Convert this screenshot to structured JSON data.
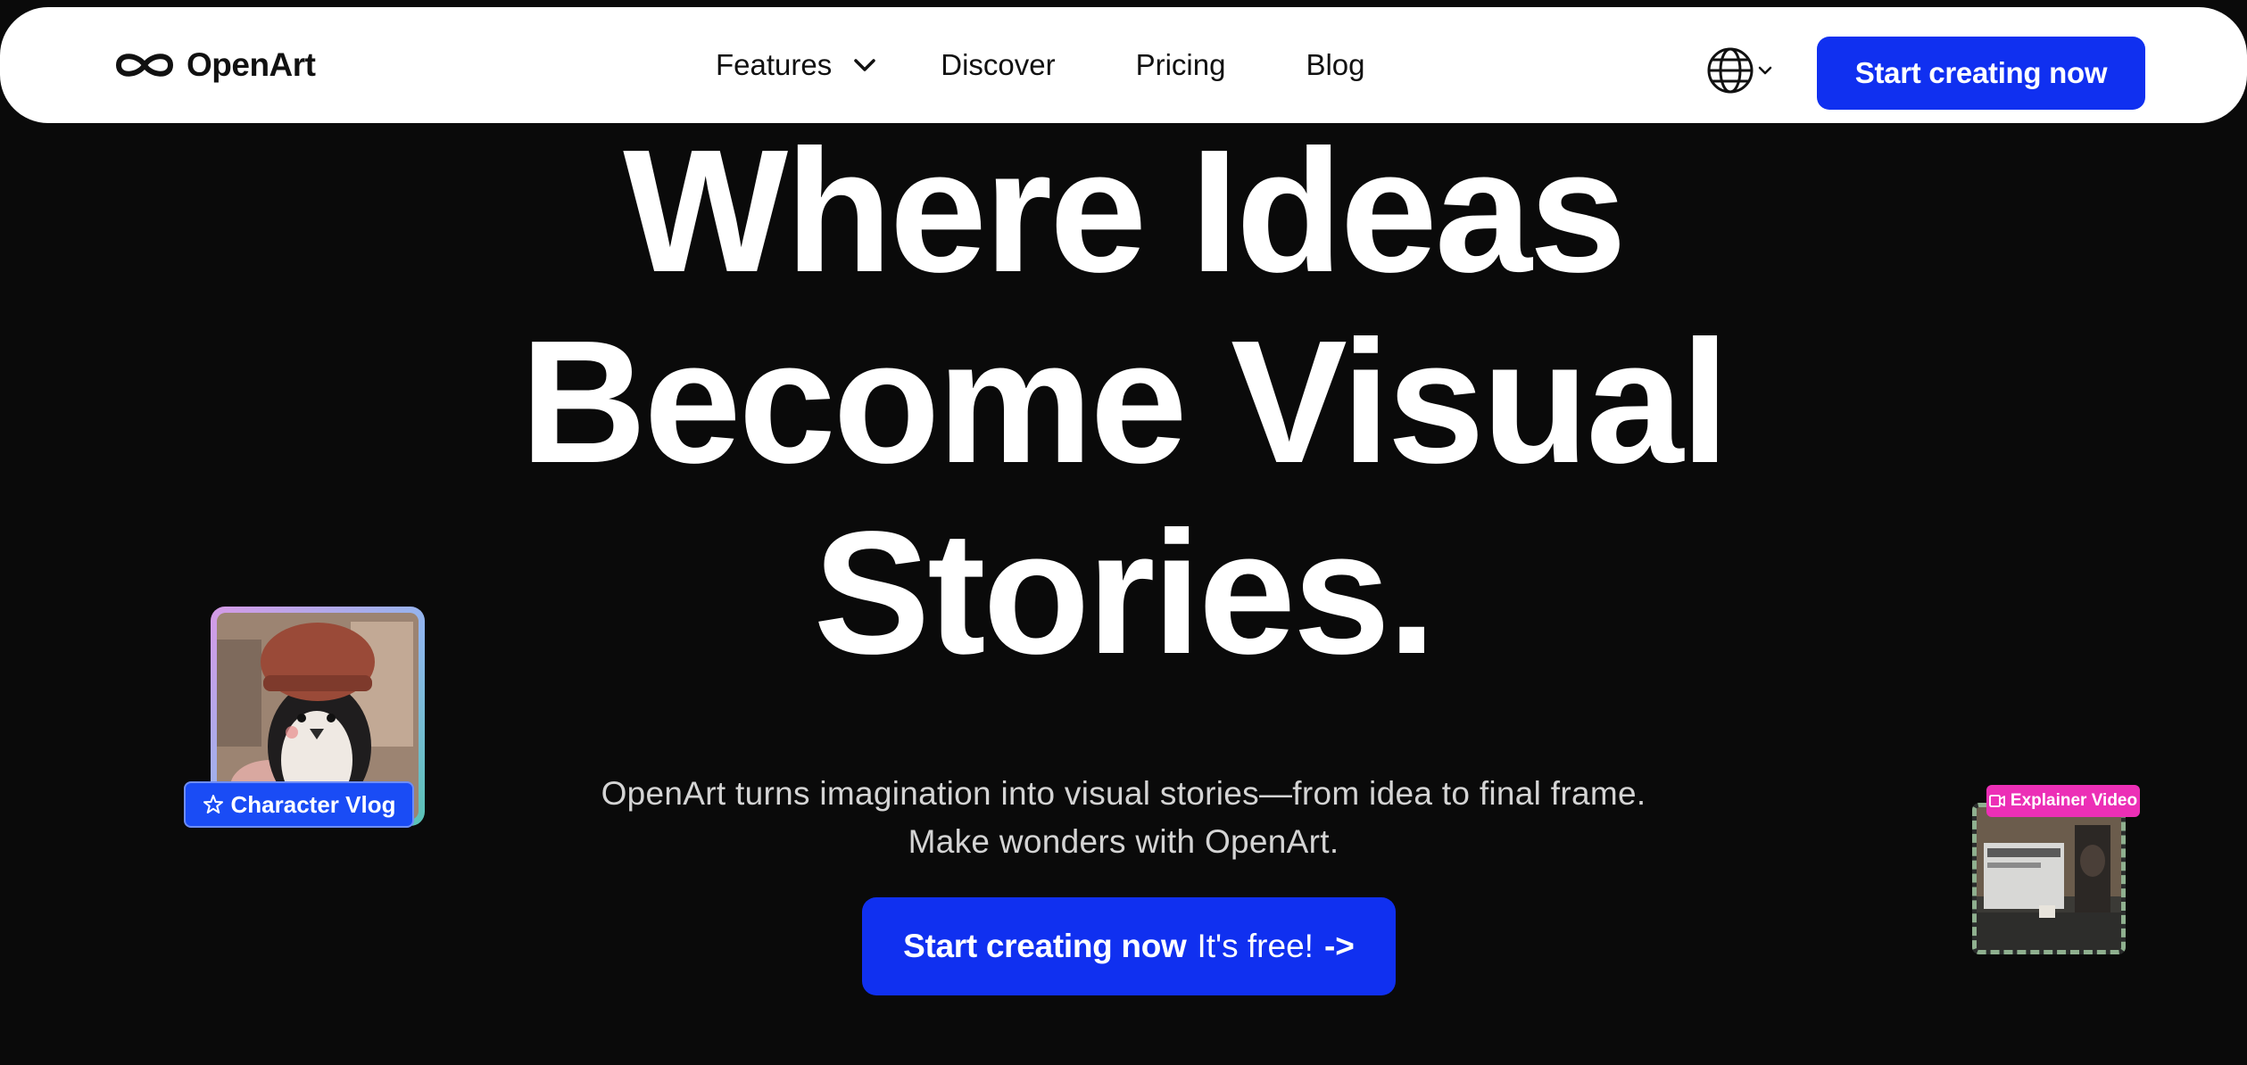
{
  "header": {
    "logo_text": "OpenArt",
    "nav": [
      {
        "label": "Features"
      },
      {
        "label": "Discover"
      },
      {
        "label": "Pricing"
      },
      {
        "label": "Blog"
      }
    ],
    "language_icon": "globe-icon",
    "cta_label": "Start creating now"
  },
  "hero": {
    "title_lines": [
      "Where Ideas",
      "Become Visual",
      "Stories."
    ],
    "subtitle_lines": [
      "OpenArt turns imagination into visual stories—from idea to final frame.",
      "Make wonders with OpenArt."
    ],
    "cta": {
      "label": "Start creating now",
      "free_text": "It's free!",
      "arrow": "->"
    }
  },
  "floating_cards": {
    "left": {
      "badge_label": "Character Vlog",
      "badge_icon": "sparkle-star-icon"
    },
    "right": {
      "badge_label": "Explainer Video",
      "badge_icon": "video-icon"
    }
  },
  "colors": {
    "background": "#0a0a0a",
    "navbar": "#ffffff",
    "brand_blue": "#1030f0",
    "badge_pink": "#ec2fb6"
  }
}
